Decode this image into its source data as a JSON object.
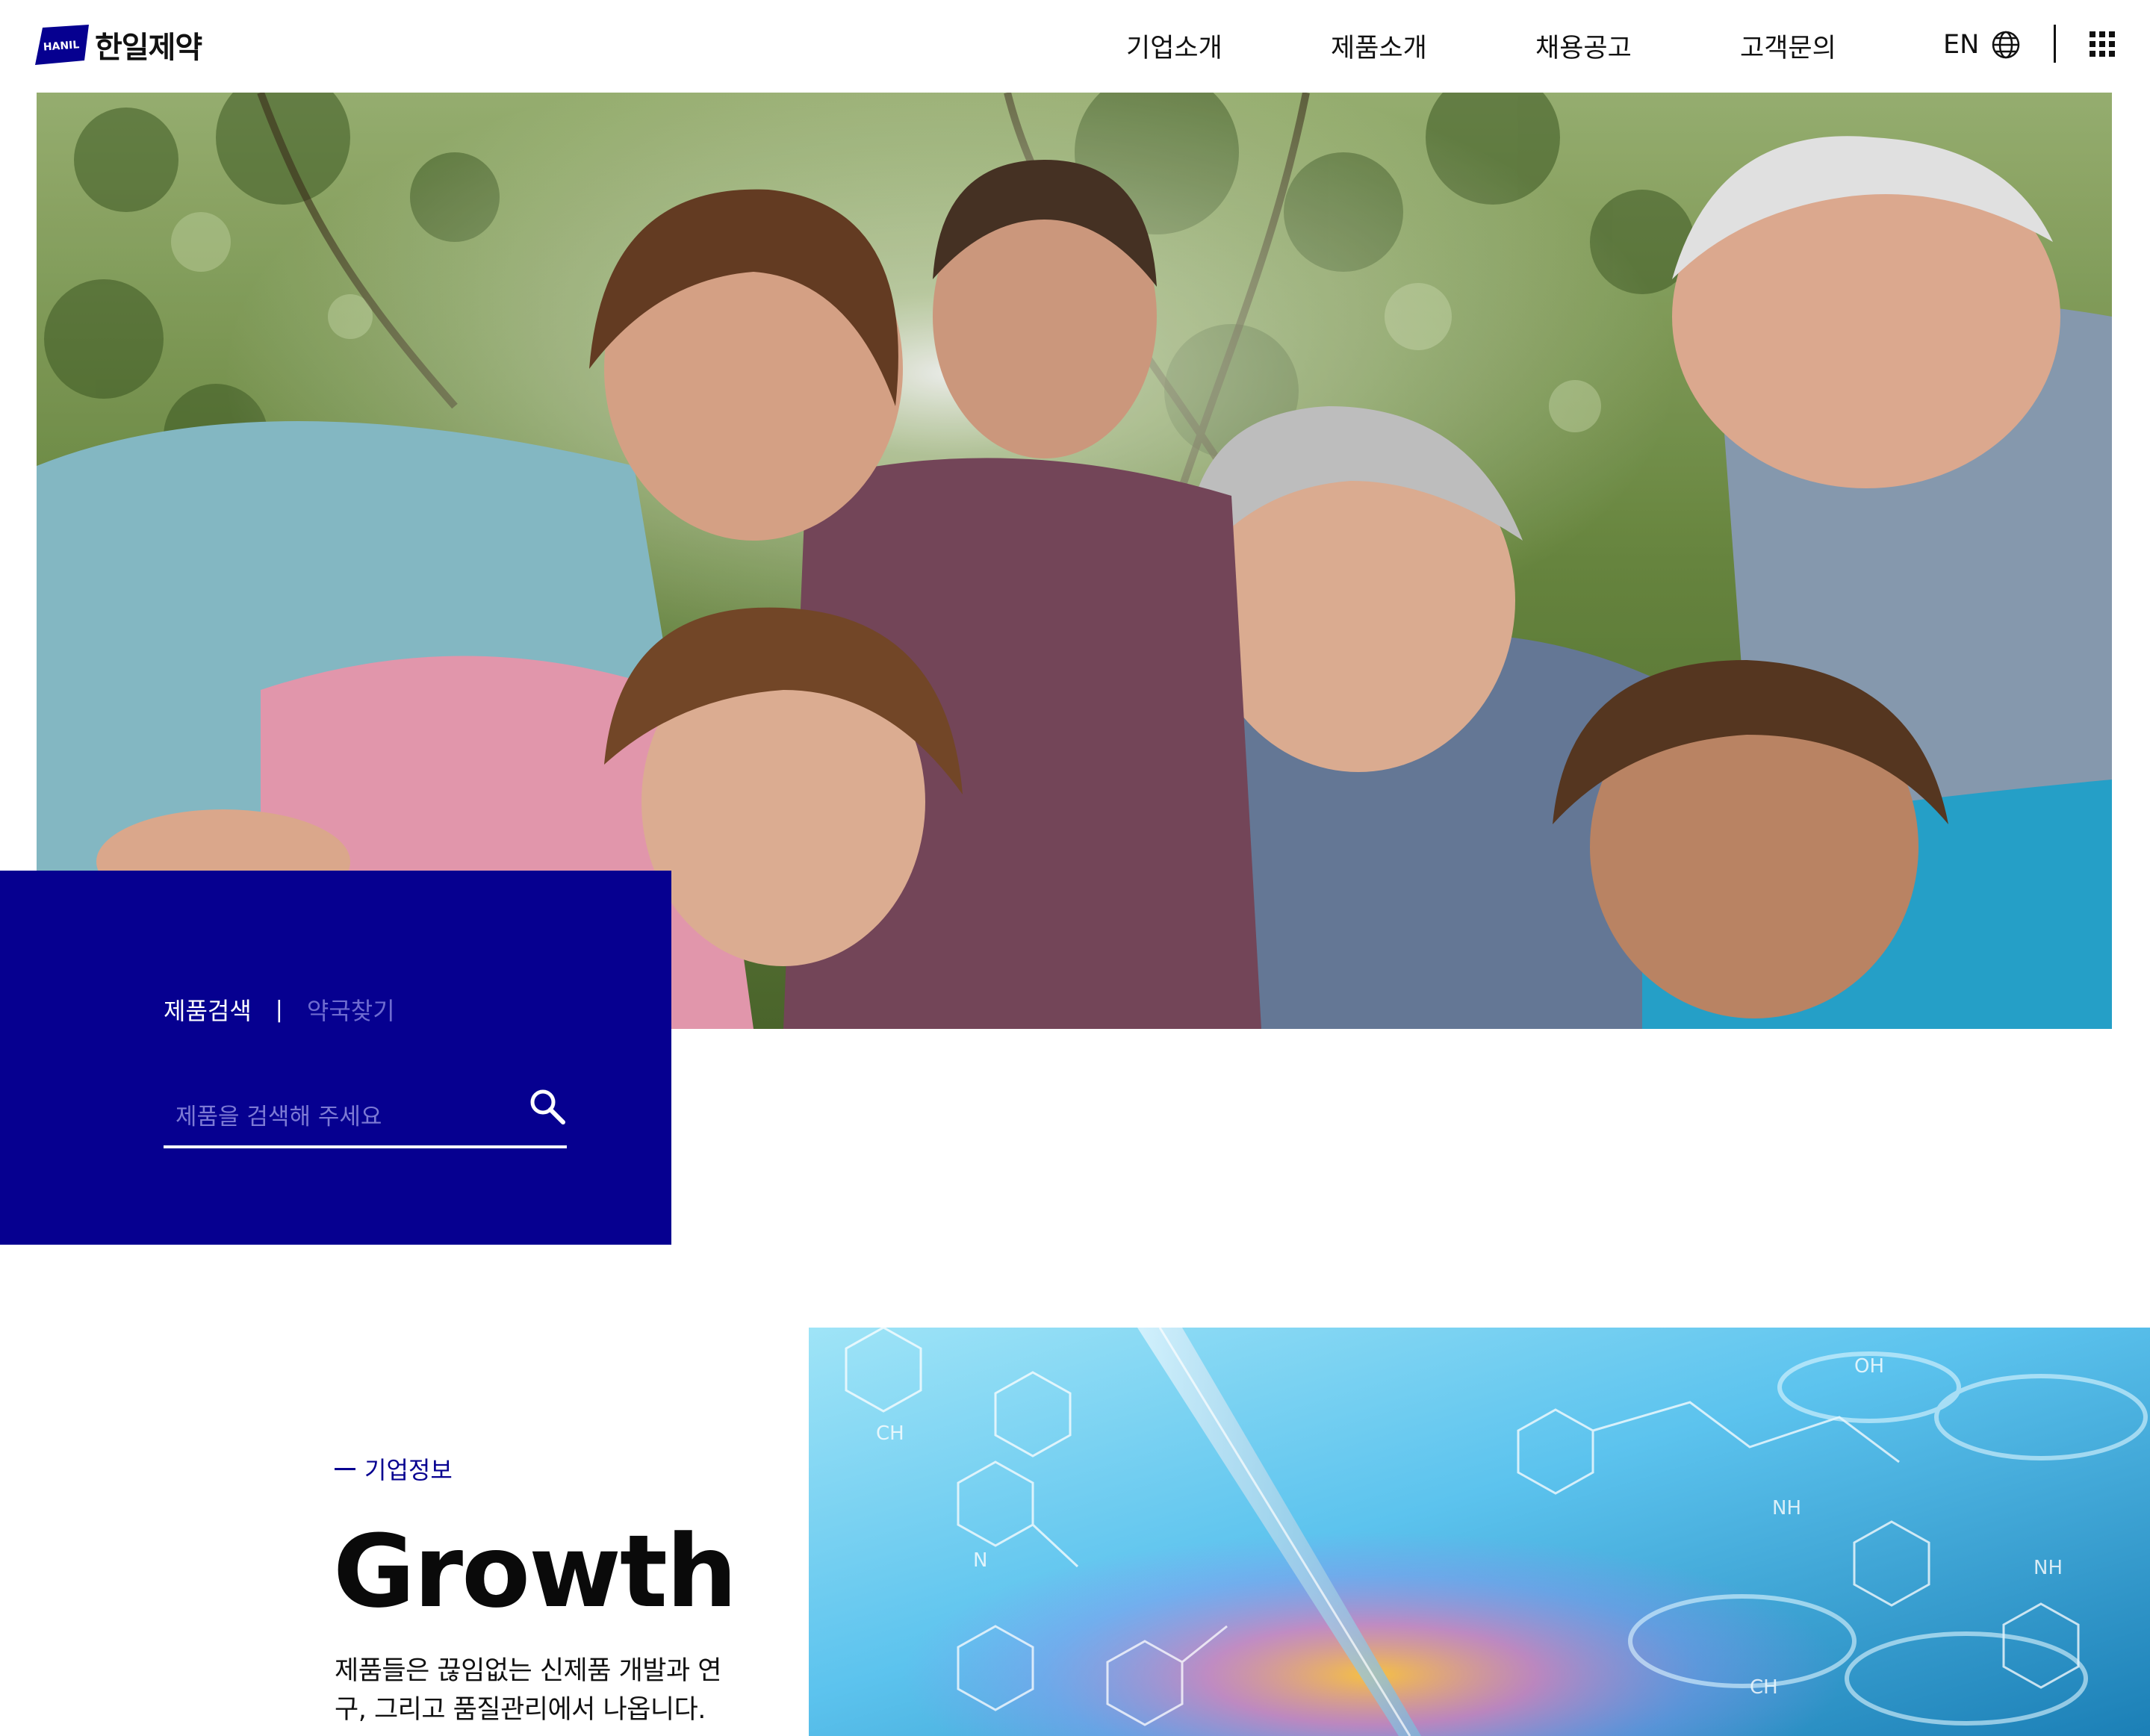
{
  "brand": {
    "logo_badge": "HANIL",
    "name": "한일제약",
    "primary_color": "#060090"
  },
  "nav": {
    "items": [
      {
        "label": "기업소개"
      },
      {
        "label": "제품소개"
      },
      {
        "label": "채용공고"
      },
      {
        "label": "고객문의"
      }
    ],
    "language": "EN",
    "language_icon": "globe-icon",
    "menu_icon": "grid-menu-icon"
  },
  "hero": {
    "image": "family-photo"
  },
  "search": {
    "tabs": [
      {
        "label": "제품검색",
        "active": true
      },
      {
        "label": "약국찾기",
        "active": false
      }
    ],
    "separator": "|",
    "placeholder": "제품을 검색해 주세요",
    "value": "",
    "icon": "search-icon"
  },
  "about": {
    "eyebrow": "기업정보",
    "title": "Growth",
    "description": "제품들은 끊임없는 신제품 개발과 연구, 그리고 품질관리에서 나옵니다.",
    "image": "laboratory-molecule-image"
  }
}
